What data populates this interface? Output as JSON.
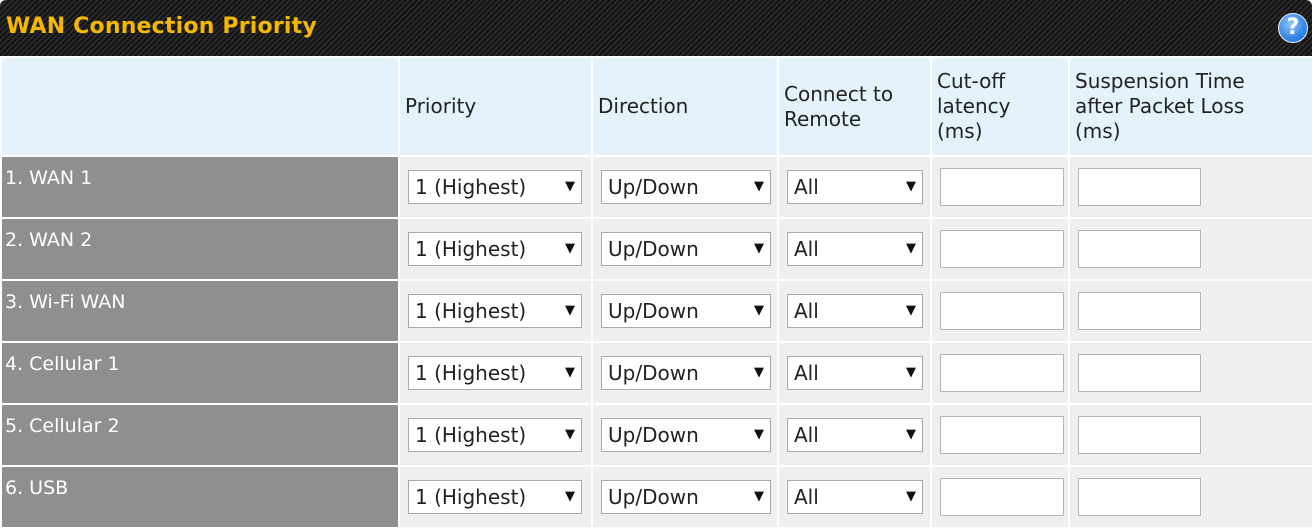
{
  "header": {
    "title": "WAN Connection Priority",
    "help_icon": "question-circle-icon"
  },
  "columns": {
    "priority": "Priority",
    "direction": "Direction",
    "connect_to_remote_1": "Connect to",
    "connect_to_remote_2": "Remote",
    "cutoff_1": "Cut-off",
    "cutoff_2": "latency",
    "cutoff_3": "(ms)",
    "suspension_1": "Suspension Time",
    "suspension_2": "after Packet Loss",
    "suspension_3": "(ms)"
  },
  "rows": [
    {
      "name": "1. WAN 1",
      "priority": "1 (Highest)",
      "direction": "Up/Down",
      "remote": "All",
      "cutoff": "",
      "suspension": ""
    },
    {
      "name": "2. WAN 2",
      "priority": "1 (Highest)",
      "direction": "Up/Down",
      "remote": "All",
      "cutoff": "",
      "suspension": ""
    },
    {
      "name": "3. Wi-Fi WAN",
      "priority": "1 (Highest)",
      "direction": "Up/Down",
      "remote": "All",
      "cutoff": "",
      "suspension": ""
    },
    {
      "name": "4. Cellular 1",
      "priority": "1 (Highest)",
      "direction": "Up/Down",
      "remote": "All",
      "cutoff": "",
      "suspension": ""
    },
    {
      "name": "5. Cellular 2",
      "priority": "1 (Highest)",
      "direction": "Up/Down",
      "remote": "All",
      "cutoff": "",
      "suspension": ""
    },
    {
      "name": "6. USB",
      "priority": "1 (Highest)",
      "direction": "Up/Down",
      "remote": "All",
      "cutoff": "",
      "suspension": ""
    }
  ],
  "colors": {
    "title": "#f5b800",
    "header_bg": "#e4f2fc",
    "row_label_bg": "#8f8f8f",
    "cell_bg": "#efefef"
  }
}
